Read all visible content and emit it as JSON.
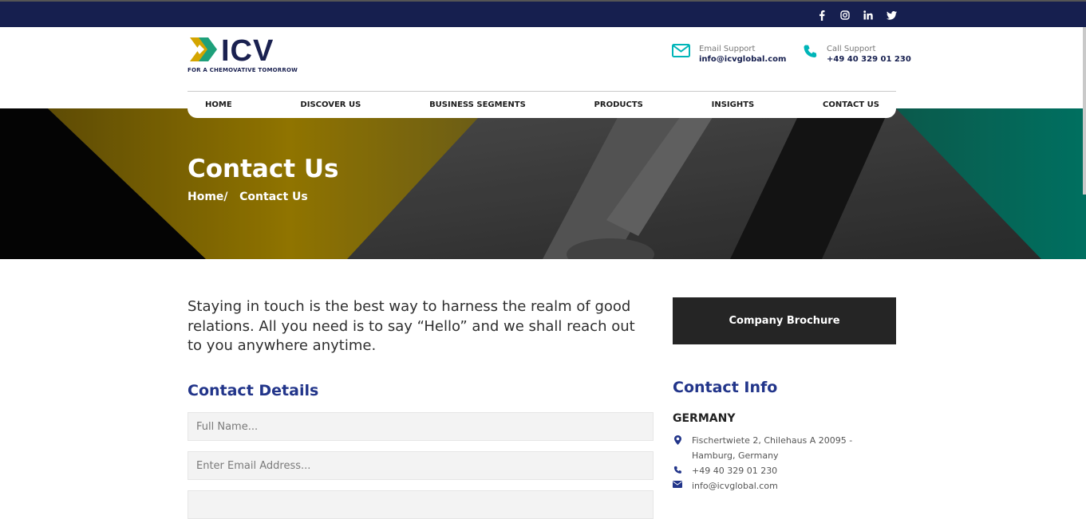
{
  "social": {
    "icons": [
      "facebook-icon",
      "instagram-icon",
      "linkedin-icon",
      "twitter-icon"
    ]
  },
  "brand": {
    "name": "ICV",
    "tagline": "FOR A CHEMOVATIVE TOMORROW",
    "colors": {
      "navy": "#161f4f",
      "teal": "#00b5b8",
      "gold": "#c9a100",
      "green": "#1ea07a"
    }
  },
  "support": {
    "email": {
      "label": "Email Support",
      "value": "info@icvglobal.com"
    },
    "phone": {
      "label": "Call Support",
      "value": "+49 40 329 01 230"
    }
  },
  "nav": {
    "items": [
      "HOME",
      "DISCOVER US",
      "BUSINESS SEGMENTS",
      "PRODUCTS",
      "INSIGHTS",
      "CONTACT US"
    ]
  },
  "hero": {
    "title": "Contact Us",
    "breadcrumb": {
      "home": "Home/",
      "current": "Contact Us"
    }
  },
  "intro": "Staying in touch is the best way to harness the realm of good relations. All you need is to say “Hello” and we shall reach out to you anywhere anytime.",
  "form": {
    "heading": "Contact Details",
    "name_placeholder": "Full Name...",
    "email_placeholder": "Enter Email Address..."
  },
  "sidebar": {
    "brochure_label": "Company Brochure",
    "info_heading": "Contact Info",
    "country": "GERMANY",
    "address": "Fischertwiete 2, Chilehaus A 20095 - Hamburg, Germany",
    "phone": "+49 40 329 01 230",
    "email": "info@icvglobal.com"
  }
}
